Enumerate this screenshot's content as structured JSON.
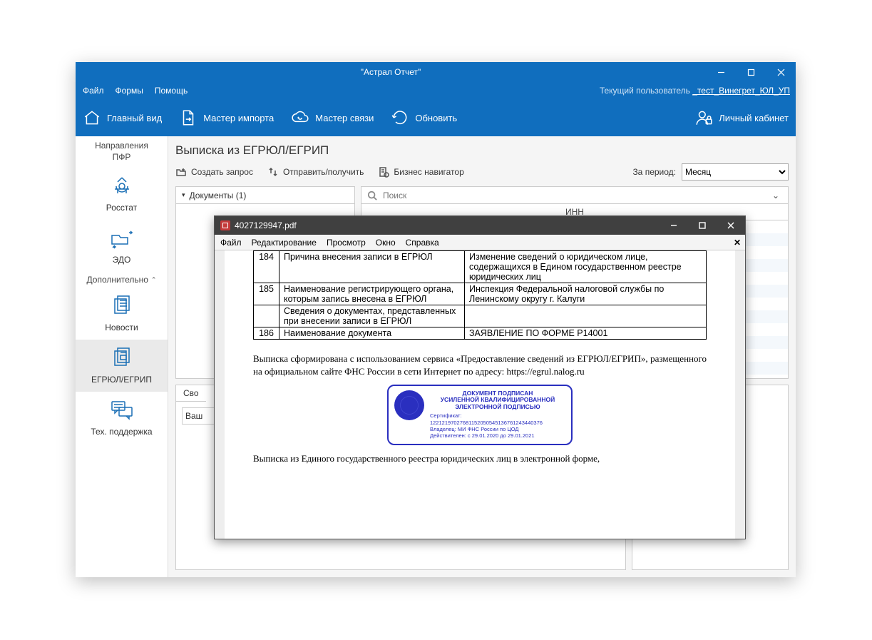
{
  "window": {
    "title": "\"Астрал Отчет\""
  },
  "menubar": {
    "items": [
      "Файл",
      "Формы",
      "Помощь"
    ],
    "current_user_label": "Текущий пользователь",
    "current_user_value": "_тест_Винегрет_ЮЛ_УП"
  },
  "ribbon": {
    "home": "Главный вид",
    "import": "Мастер импорта",
    "connect": "Мастер связи",
    "refresh": "Обновить",
    "cabinet": "Личный кабинет"
  },
  "sidebar": {
    "header": "Направления",
    "sub": "ПФР",
    "extra_header": "Дополнительно",
    "items": [
      {
        "id": "rosstat",
        "label": "Росстат"
      },
      {
        "id": "edo",
        "label": "ЭДО"
      },
      {
        "id": "news",
        "label": "Новости"
      },
      {
        "id": "egrul",
        "label": "ЕГРЮЛ/ЕГРИП"
      },
      {
        "id": "support",
        "label": "Тех. поддержка"
      }
    ]
  },
  "main": {
    "title": "Выписка из ЕГРЮЛ/ЕГРИП",
    "actions": {
      "create": "Создать запрос",
      "sendrecv": "Отправить/получить",
      "navigator": "Бизнес навигатор"
    },
    "period_label": "За период:",
    "period_value": "Месяц",
    "docs_header": "Документы (1)",
    "search_placeholder": "Поиск",
    "inn_col": "ИНН",
    "props_tab": "Сво",
    "props_text": "Ваш",
    "period_options": [
      "Месяц"
    ]
  },
  "pdf": {
    "filename": "4027129947.pdf",
    "menu": [
      "Файл",
      "Редактирование",
      "Просмотр",
      "Окно",
      "Справка"
    ],
    "rows": [
      {
        "n": "184",
        "label": "Причина внесения записи в ЕГРЮЛ",
        "value": "Изменение сведений о юридическом лице, содержащихся в Едином государственном реестре юридических лиц"
      },
      {
        "n": "185",
        "label": "Наименование регистрирующего органа, которым запись внесена в ЕГРЮЛ",
        "value": "Инспекция Федеральной налоговой службы по Ленинскому округу г. Калуги"
      },
      {
        "n": "",
        "label": "Сведения о документах, представленных при внесении записи в ЕГРЮЛ",
        "value": ""
      },
      {
        "n": "186",
        "label": "Наименование документа",
        "value": "ЗАЯВЛЕНИЕ ПО ФОРМЕ Р14001"
      }
    ],
    "note": "Выписка сформирована с использованием сервиса «Предоставление сведений из ЕГРЮЛ/ЕГРИП», размещенного на официальном сайте ФНС России в сети Интернет по адресу: https://egrul.nalog.ru",
    "stamp": {
      "head1": "ДОКУМЕНТ ПОДПИСАН",
      "head2": "УСИЛЕННОЙ КВАЛИФИЦИРОВАННОЙ",
      "head3": "ЭЛЕКТРОННОЙ ПОДПИСЬЮ",
      "cert": "Сертификат: 12212197027681152050545136761243440376",
      "owner": "Владелец: МИ ФНС России по ЦОД",
      "valid": "Действителен: с 29.01.2020 до 29.01.2021"
    },
    "footer": "Выписка из Единого государственного реестра юридических лиц в электронной форме,"
  }
}
